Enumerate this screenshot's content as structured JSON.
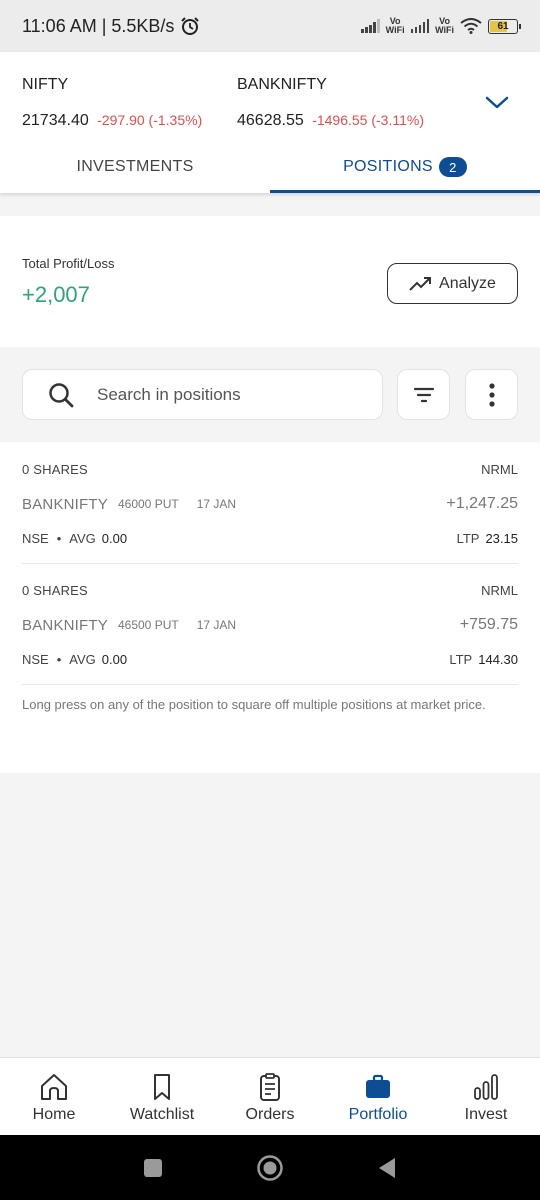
{
  "status_bar": {
    "time": "11:06 AM | 5.5KB/s",
    "alarm_icon": "alarm-clock-icon",
    "vo_wifi_1": "Vo\nWiFi",
    "vo_wifi_2": "Vo\nWiFi",
    "battery": "61"
  },
  "indices": [
    {
      "name": "NIFTY",
      "value": "21734.40",
      "change": "-297.90 (-1.35%)"
    },
    {
      "name": "BANKNIFTY",
      "value": "46628.55",
      "change": "-1496.55 (-3.11%)"
    }
  ],
  "tabs": {
    "investments": "INVESTMENTS",
    "positions": "POSITIONS",
    "positions_count": "2"
  },
  "summary": {
    "label": "Total Profit/Loss",
    "value": "+2,007",
    "analyze_label": "Analyze"
  },
  "search": {
    "placeholder": "Search in positions"
  },
  "positions": [
    {
      "shares": "0 SHARES",
      "product": "NRML",
      "symbol": "BANKNIFTY",
      "strike": "46000 PUT",
      "expiry": "17 JAN",
      "pnl": "+1,247.25",
      "exchange": "NSE",
      "avg_label": "AVG",
      "avg": "0.00",
      "ltp_label": "LTP",
      "ltp": "23.15"
    },
    {
      "shares": "0 SHARES",
      "product": "NRML",
      "symbol": "BANKNIFTY",
      "strike": "46500 PUT",
      "expiry": "17 JAN",
      "pnl": "+759.75",
      "exchange": "NSE",
      "avg_label": "AVG",
      "avg": "0.00",
      "ltp_label": "LTP",
      "ltp": "144.30"
    }
  ],
  "note": "Long press on any of the position to square off multiple positions at market price.",
  "bottom_nav": [
    {
      "label": "Home",
      "icon": "home-icon"
    },
    {
      "label": "Watchlist",
      "icon": "bookmark-icon"
    },
    {
      "label": "Orders",
      "icon": "clipboard-icon"
    },
    {
      "label": "Portfolio",
      "icon": "briefcase-icon",
      "active": true
    },
    {
      "label": "Invest",
      "icon": "bar-chart-icon"
    }
  ],
  "colors": {
    "accent": "#0d4d93",
    "profit": "#2fa37a",
    "loss": "#e04e4e"
  }
}
